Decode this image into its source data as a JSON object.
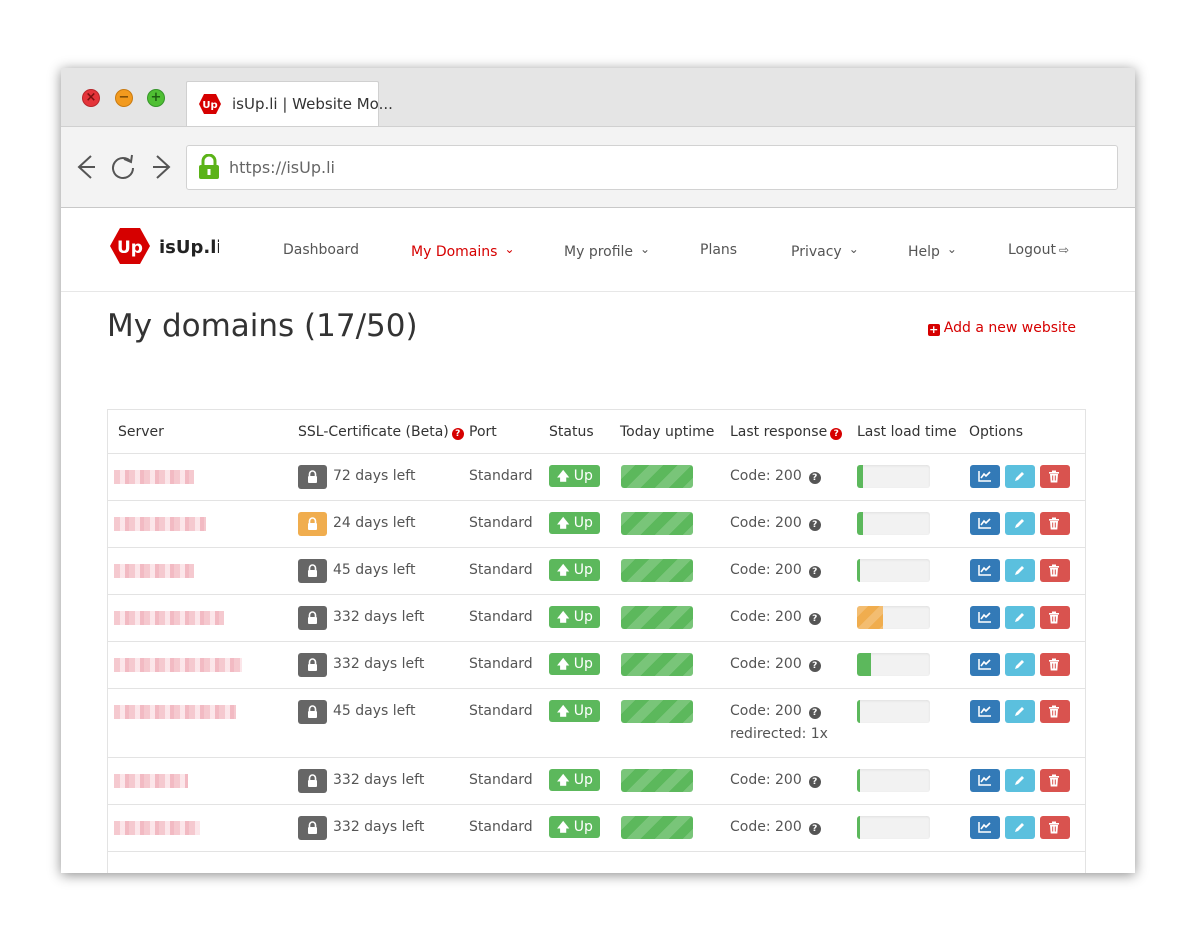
{
  "browser": {
    "tab_title": "isUp.li | Website Mo...",
    "url": "https://isUp.li"
  },
  "nav": {
    "logo_text": "isUp.li",
    "items": [
      {
        "label": "Dashboard",
        "dropdown": false,
        "active": false
      },
      {
        "label": "My Domains",
        "dropdown": true,
        "active": true
      },
      {
        "label": "My profile",
        "dropdown": true,
        "active": false
      },
      {
        "label": "Plans",
        "dropdown": false,
        "active": false
      },
      {
        "label": "Privacy",
        "dropdown": true,
        "active": false
      },
      {
        "label": "Help",
        "dropdown": true,
        "active": false
      },
      {
        "label": "Logout",
        "dropdown": false,
        "active": false
      }
    ]
  },
  "page": {
    "title": "My domains (17/50)",
    "add_website": "Add a new website"
  },
  "table": {
    "headers": [
      "Server",
      "SSL-Certificate (Beta)",
      "Port",
      "Status",
      "Today uptime",
      "Last response",
      "Last load time",
      "Options"
    ],
    "rows": [
      {
        "ssl": "72 days left",
        "ssl_status": "ok",
        "port": "Standard",
        "status": "Up",
        "response": "Code: 200",
        "redirect": "",
        "load_fraction": 0.08,
        "load_status": "ok"
      },
      {
        "ssl": "24 days left",
        "ssl_status": "warn",
        "port": "Standard",
        "status": "Up",
        "response": "Code: 200",
        "redirect": "",
        "load_fraction": 0.08,
        "load_status": "ok"
      },
      {
        "ssl": "45 days left",
        "ssl_status": "ok",
        "port": "Standard",
        "status": "Up",
        "response": "Code: 200",
        "redirect": "",
        "load_fraction": 0.04,
        "load_status": "ok"
      },
      {
        "ssl": "332 days left",
        "ssl_status": "ok",
        "port": "Standard",
        "status": "Up",
        "response": "Code: 200",
        "redirect": "",
        "load_fraction": 0.35,
        "load_status": "warn"
      },
      {
        "ssl": "332 days left",
        "ssl_status": "ok",
        "port": "Standard",
        "status": "Up",
        "response": "Code: 200",
        "redirect": "",
        "load_fraction": 0.19,
        "load_status": "ok"
      },
      {
        "ssl": "45 days left",
        "ssl_status": "ok",
        "port": "Standard",
        "status": "Up",
        "response": "Code: 200",
        "redirect": "redirected: 1x",
        "load_fraction": 0.04,
        "load_status": "ok"
      },
      {
        "ssl": "332 days left",
        "ssl_status": "ok",
        "port": "Standard",
        "status": "Up",
        "response": "Code: 200",
        "redirect": "",
        "load_fraction": 0.03,
        "load_status": "ok"
      },
      {
        "ssl": "332 days left",
        "ssl_status": "ok",
        "port": "Standard",
        "status": "Up",
        "response": "Code: 200",
        "redirect": "",
        "load_fraction": 0.02,
        "load_status": "ok"
      }
    ]
  },
  "colors": {
    "brand_red": "#d60000",
    "success_green": "#5cb85c",
    "warning_orange": "#f0ad4e",
    "primary_blue": "#337ab7",
    "info_cyan": "#5bc0de",
    "danger_red": "#d9534f"
  },
  "icons": {
    "status_up": "arrow-up-icon",
    "stats": "line-chart-icon",
    "edit": "pencil-icon",
    "delete": "trash-icon",
    "ssl": "lock-icon",
    "help": "question-circle-icon",
    "logout": "sign-out-icon",
    "add": "plus-square-icon"
  }
}
